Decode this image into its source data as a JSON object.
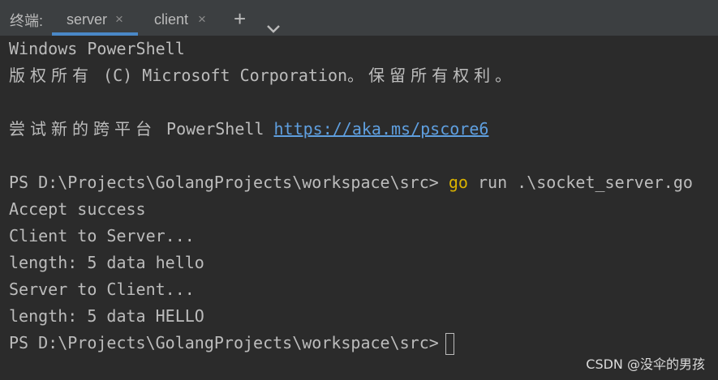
{
  "tabbar": {
    "label": "终端:",
    "tabs": [
      {
        "label": "server",
        "close": "×"
      },
      {
        "label": "client",
        "close": "×"
      }
    ],
    "add_icon": "plus-icon",
    "more_icon": "chevron-down-icon"
  },
  "terminal": {
    "line1": "Windows PowerShell",
    "line2_cjk1": "版权所有",
    "line2_mid": " (C) Microsoft Corporation",
    "line2_cjk2": "。保留所有权利。",
    "line4_cjk": "尝试新的跨平台",
    "line4_text": " PowerShell ",
    "line4_link": "https://aka.ms/pscore6",
    "prompt": "PS D:\\Projects\\GolangProjects\\workspace\\src>",
    "cmd_keyword": "go",
    "cmd_rest": " run .\\socket_server.go",
    "out1": "Accept success",
    "out2": "Client to Server...",
    "out3": "length: 5 data hello",
    "out4": "Server to Client...",
    "out5": "length: 5 data HELLO",
    "prompt2": "PS D:\\Projects\\GolangProjects\\workspace\\src>"
  },
  "watermark": "CSDN @没伞的男孩",
  "colors": {
    "background": "#2b2b2b",
    "tabbar": "#3c3f41",
    "accent": "#4a88c7",
    "link": "#5f9fdf",
    "keyword": "#d9b200"
  }
}
